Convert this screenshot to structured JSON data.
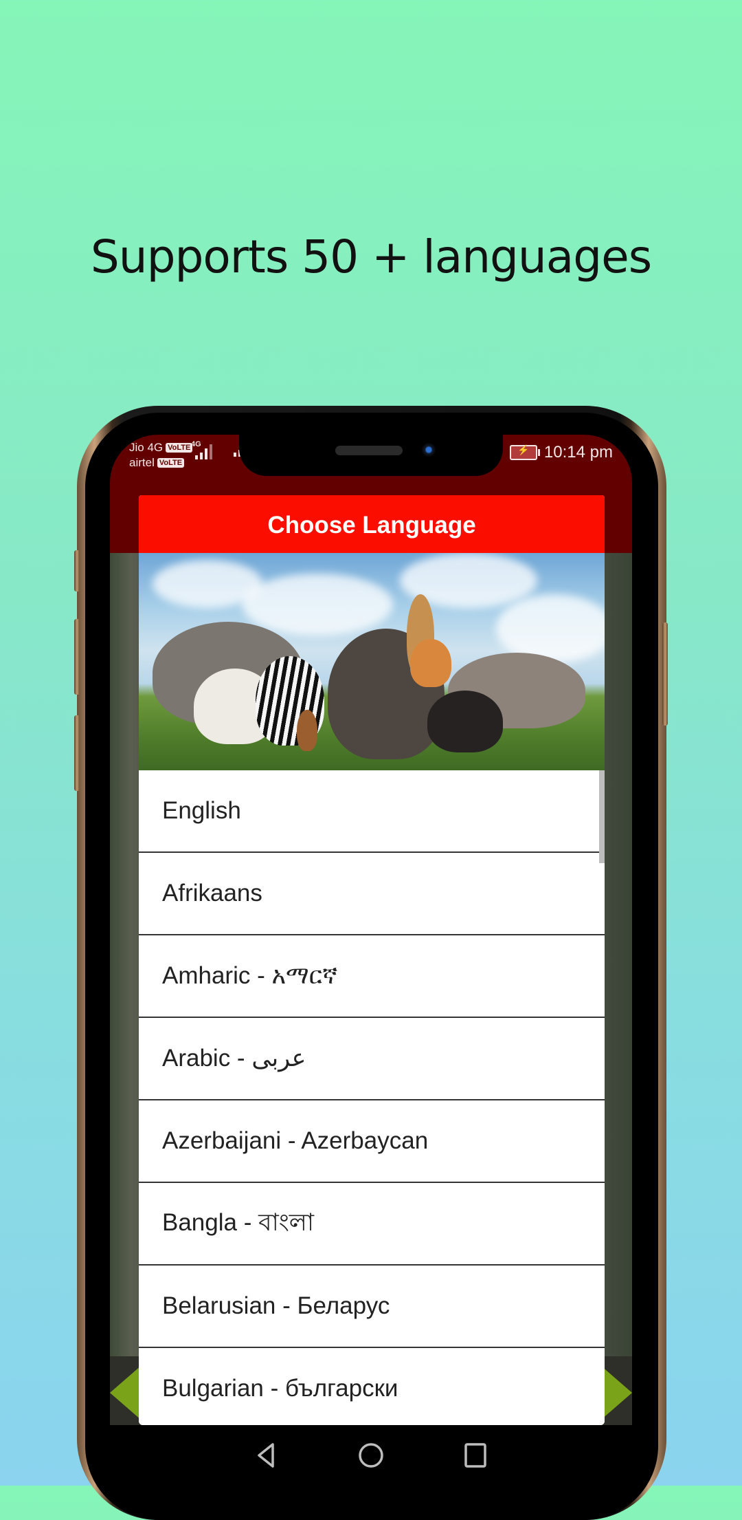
{
  "headline": "Supports 50 + languages",
  "status_bar": {
    "carrier_1": "Jio 4G",
    "carrier_1_badge": "VoLTE",
    "carrier_2": "airtel",
    "carrier_2_badge": "VoLTE",
    "network_type": "4G",
    "time": "10:14 pm",
    "battery_icon": "battery-charging-icon"
  },
  "dialog": {
    "title": "Choose Language",
    "banner_description": "Group of wild animals on grass under cloudy sky",
    "languages": [
      "English",
      "Afrikaans",
      "Amharic - አማርኛ",
      "Arabic - عربى",
      "Azerbaijani - Azerbaycan",
      "Bangla - বাংলা",
      "Belarusian - Беларус",
      "Bulgarian - български"
    ]
  },
  "navigation": {
    "back": "back-icon",
    "home": "home-icon",
    "recents": "recents-icon"
  },
  "colors": {
    "dialog_header": "#fb0d00",
    "status_bar": "#620000",
    "page_bg_top": "#86f5b8",
    "page_bg_bottom": "#8bd3ef"
  }
}
